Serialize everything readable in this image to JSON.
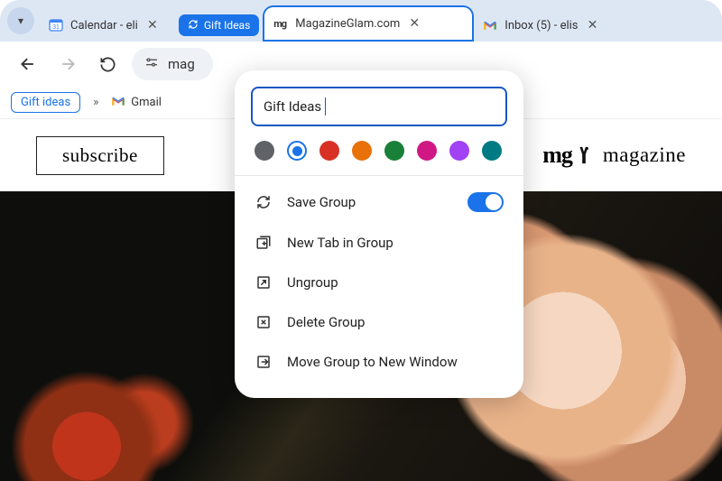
{
  "tabs": {
    "dropdown_glyph": "▾",
    "calendar": {
      "title": "Calendar - eli"
    },
    "group_chip": {
      "label": "Gift Ideas"
    },
    "active": {
      "title": "MagazineGlam.com",
      "logo_text": "mg"
    },
    "gmail": {
      "title": "Inbox (5) - elis"
    }
  },
  "toolbar": {
    "omnibox_text": "mag",
    "site_controls_glyph": "⚙"
  },
  "bookmarks": {
    "folder": "Gift ideas",
    "overflow": "»",
    "gmail": "Gmail"
  },
  "page": {
    "subscribe": "subscribe",
    "brand_logo": "mg",
    "brand_text": "magazine"
  },
  "popup": {
    "group_name": "Gift Ideas",
    "colors": [
      {
        "hex": "#5f6368",
        "selected": false
      },
      {
        "hex": "#1a73e8",
        "selected": true
      },
      {
        "hex": "#d93025",
        "selected": false
      },
      {
        "hex": "#e8710a",
        "selected": false
      },
      {
        "hex": "#188038",
        "selected": false
      },
      {
        "hex": "#d01884",
        "selected": false
      },
      {
        "hex": "#a142f4",
        "selected": false
      },
      {
        "hex": "#007b83",
        "selected": false
      }
    ],
    "save_group": "Save Group",
    "save_group_on": true,
    "new_tab": "New Tab in Group",
    "ungroup": "Ungroup",
    "delete": "Delete Group",
    "move": "Move Group to New Window"
  }
}
